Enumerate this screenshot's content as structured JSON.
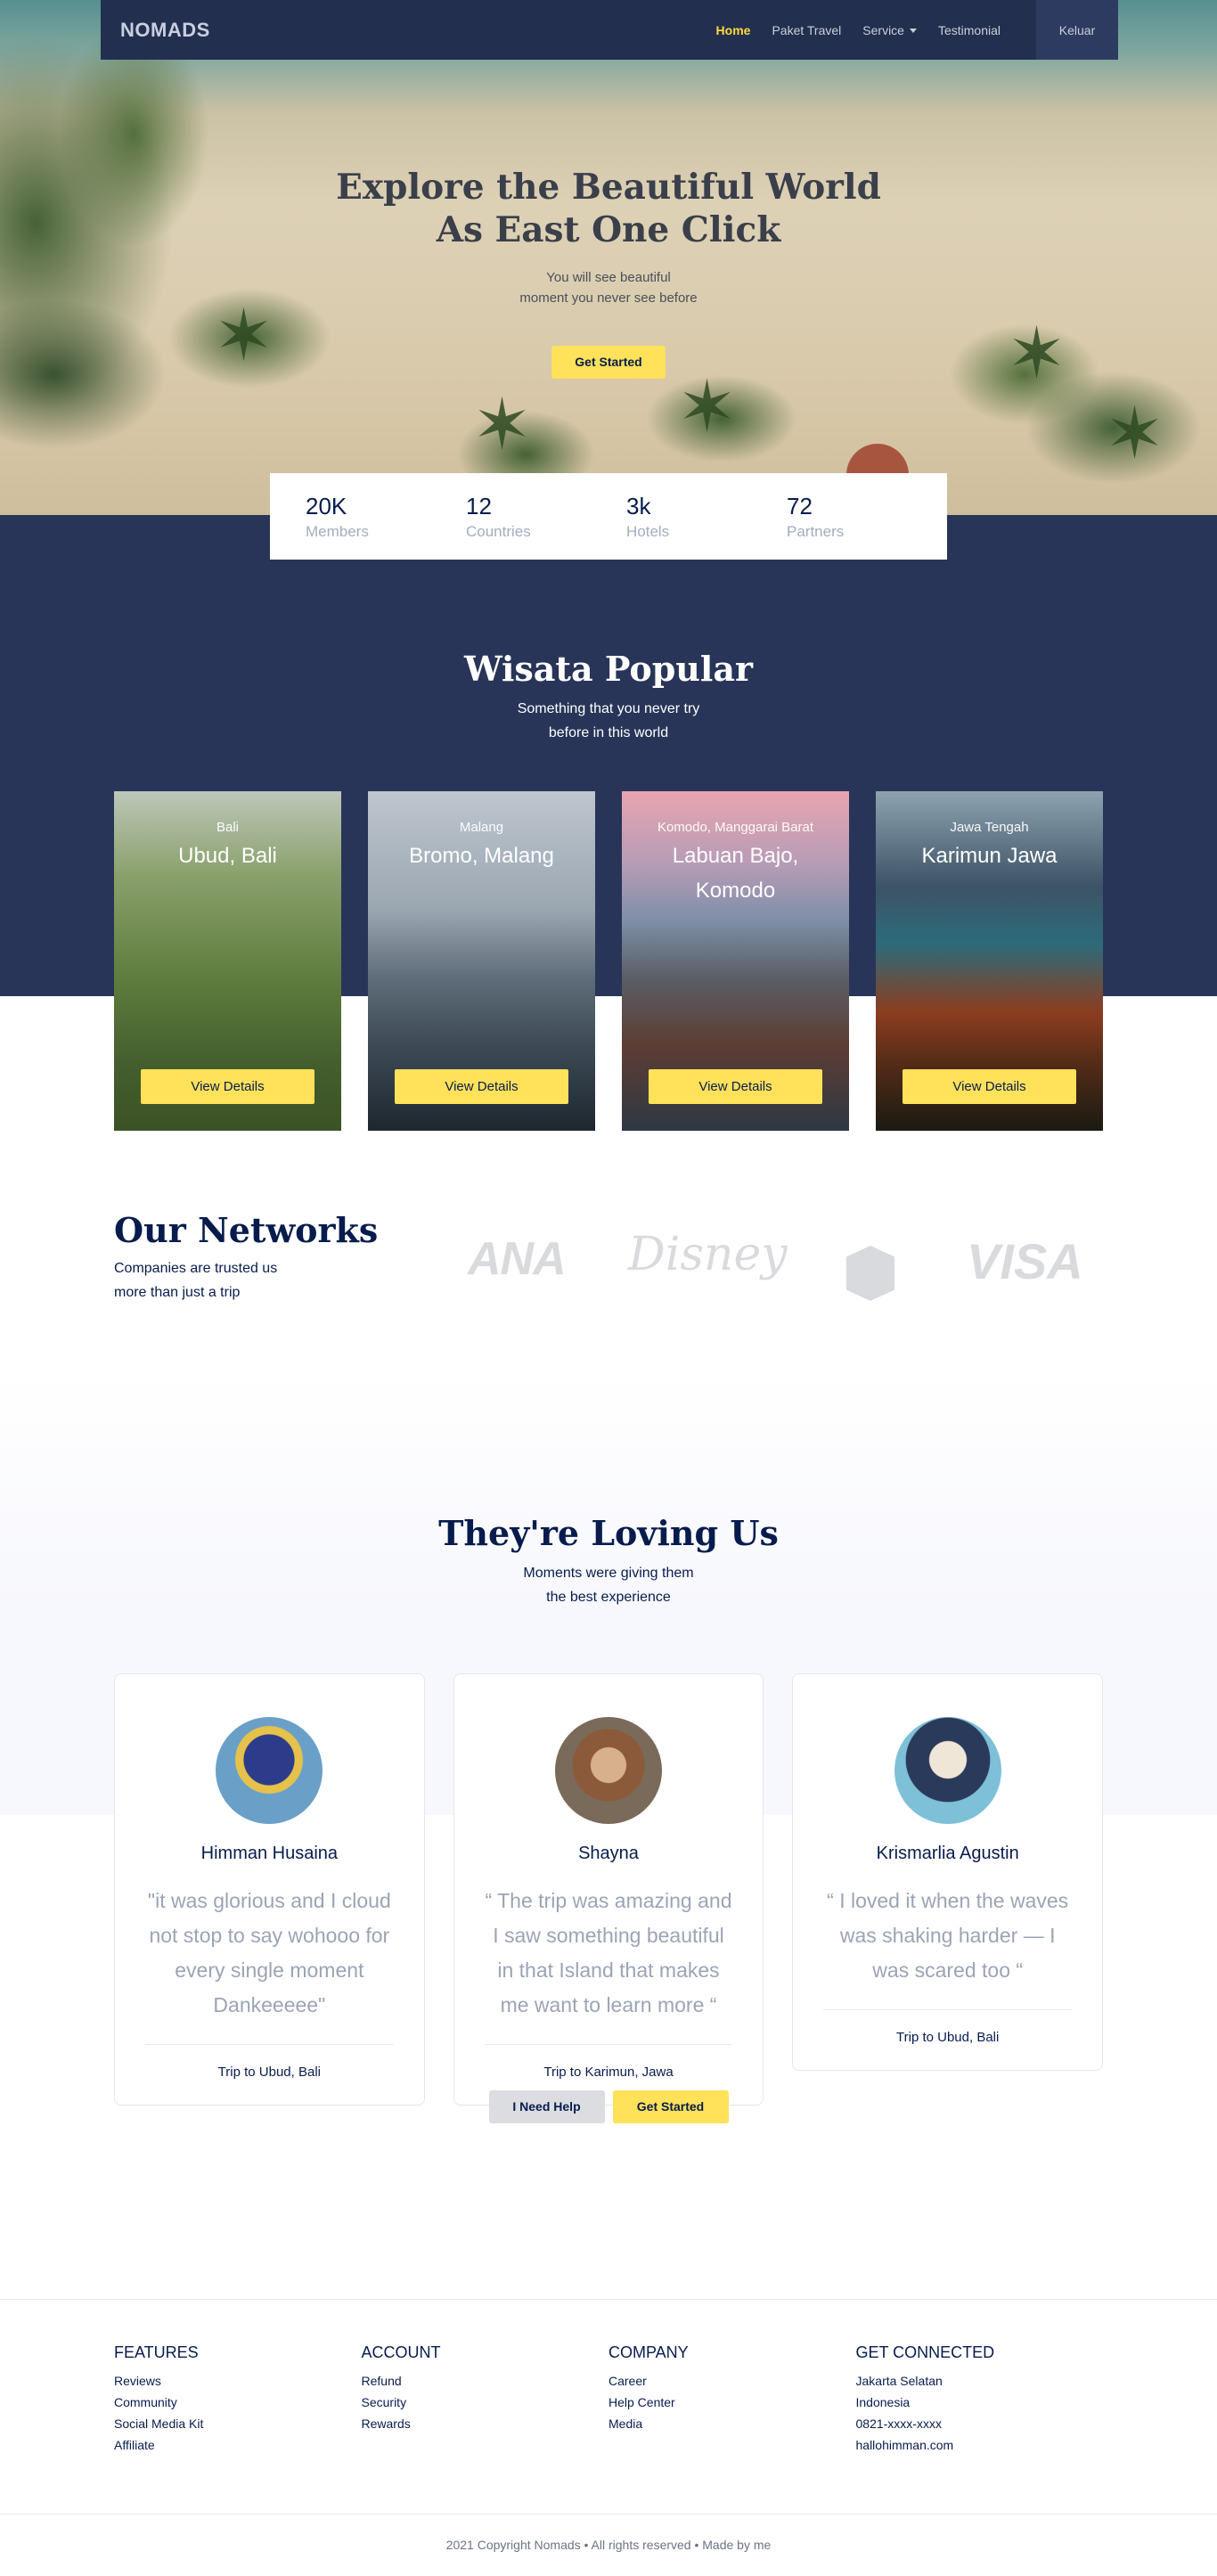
{
  "brand": {
    "logo_text": "NOMADS",
    "accent_color": "#FFD93D",
    "navy": "#283558"
  },
  "nav": {
    "items": [
      {
        "label": "Home",
        "active": true
      },
      {
        "label": "Paket Travel",
        "active": false
      },
      {
        "label": "Service",
        "active": false,
        "has_dropdown": true
      },
      {
        "label": "Testimonial",
        "active": false
      }
    ],
    "logout_label": "Keluar"
  },
  "hero": {
    "title_line1": "Explore the Beautiful World",
    "title_line2": "As East One Click",
    "subtitle_line1": "You will see beautiful",
    "subtitle_line2": "moment you never see before",
    "cta_label": "Get Started"
  },
  "stats": [
    {
      "value": "20K",
      "label": "Members"
    },
    {
      "value": "12",
      "label": "Countries"
    },
    {
      "value": "3k",
      "label": "Hotels"
    },
    {
      "value": "72",
      "label": "Partners"
    }
  ],
  "popular": {
    "title": "Wisata Popular",
    "subtitle_line1": "Something that you never try",
    "subtitle_line2": "before in this world",
    "cards": [
      {
        "location": "Bali",
        "name": "Ubud, Bali",
        "button": "View Details"
      },
      {
        "location": "Malang",
        "name": "Bromo, Malang",
        "button": "View Details"
      },
      {
        "location": "Komodo, Manggarai Barat",
        "name": "Labuan Bajo, Komodo",
        "button": "View Details"
      },
      {
        "location": "Jawa Tengah",
        "name": "Karimun Jawa",
        "button": "View Details"
      }
    ]
  },
  "networks": {
    "title": "Our Networks",
    "subtitle_line1": "Companies are trusted us",
    "subtitle_line2": "more than just a trip",
    "logos": [
      {
        "name": "ana-logo",
        "text": "ANA"
      },
      {
        "name": "disney-logo",
        "text": "Disney"
      },
      {
        "name": "shield-logo",
        "text": ""
      },
      {
        "name": "visa-logo",
        "text": "VISA"
      }
    ]
  },
  "testimonials": {
    "title": "They're Loving Us",
    "subtitle_line1": "Moments were giving them",
    "subtitle_line2": "the best experience",
    "items": [
      {
        "name": "Himman Husaina",
        "quote": "\"it was glorious and I cloud not stop to say wohooo for every single moment Dankeeeee\"",
        "trip": "Trip to Ubud, Bali"
      },
      {
        "name": "Shayna",
        "quote": "“ The trip was amazing and I saw something beautiful in that Island that makes me want to learn more “",
        "trip": "Trip to Karimun, Jawa"
      },
      {
        "name": "Krismarlia Agustin",
        "quote": "“ I loved it when the waves was shaking harder — I was scared too “",
        "trip": "Trip to Ubud, Bali"
      }
    ]
  },
  "cta": {
    "help_label": "I Need Help",
    "start_label": "Get Started"
  },
  "footer": {
    "columns": [
      {
        "heading": "FEATURES",
        "items": [
          "Reviews",
          "Community",
          "Social Media Kit",
          "Affiliate"
        ]
      },
      {
        "heading": "ACCOUNT",
        "items": [
          "Refund",
          "Security",
          "Rewards"
        ]
      },
      {
        "heading": "COMPANY",
        "items": [
          "Career",
          "Help Center",
          "Media"
        ]
      },
      {
        "heading": "GET CONNECTED",
        "items": [
          "Jakarta Selatan",
          "Indonesia",
          "0821-xxxx-xxxx",
          "hallohimman.com"
        ]
      }
    ],
    "copyright": "2021 Copyright Nomads • All rights reserved • Made by me"
  }
}
